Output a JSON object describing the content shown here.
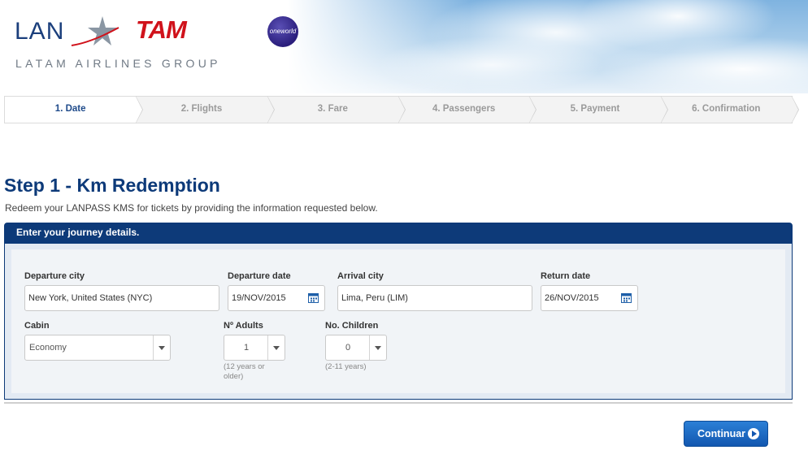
{
  "header": {
    "brand_lan": "LAN",
    "brand_tam": "TAM",
    "group": "LATAM AIRLINES GROUP",
    "alliance": "oneworld"
  },
  "steps": [
    {
      "label": "1. Date",
      "active": true
    },
    {
      "label": "2. Flights",
      "active": false
    },
    {
      "label": "3. Fare",
      "active": false
    },
    {
      "label": "4. Passengers",
      "active": false
    },
    {
      "label": "5. Payment",
      "active": false
    },
    {
      "label": "6. Confirmation",
      "active": false
    }
  ],
  "page": {
    "title": "Step 1 - Km Redemption",
    "subtitle": "Redeem your LANPASS KMS for tickets by providing the information requested below."
  },
  "form": {
    "panel_title": "Enter your journey details.",
    "departure_city": {
      "label": "Departure city",
      "value": "New York, United States (NYC)"
    },
    "departure_date": {
      "label": "Departure date",
      "value": "19/NOV/2015"
    },
    "arrival_city": {
      "label": "Arrival city",
      "value": "Lima, Peru (LIM)"
    },
    "return_date": {
      "label": "Return date",
      "value": "26/NOV/2015"
    },
    "cabin": {
      "label": "Cabin",
      "value": "Economy"
    },
    "adults": {
      "label": "Nº Adults",
      "value": "1",
      "hint": "(12 years or older)"
    },
    "children": {
      "label": "No. Children",
      "value": "0",
      "hint": "(2-11 years)"
    }
  },
  "actions": {
    "continue_label": "Continuar"
  },
  "colors": {
    "brand_blue": "#0d3a79",
    "tam_red": "#d0121b",
    "button_blue": "#1257b0"
  }
}
